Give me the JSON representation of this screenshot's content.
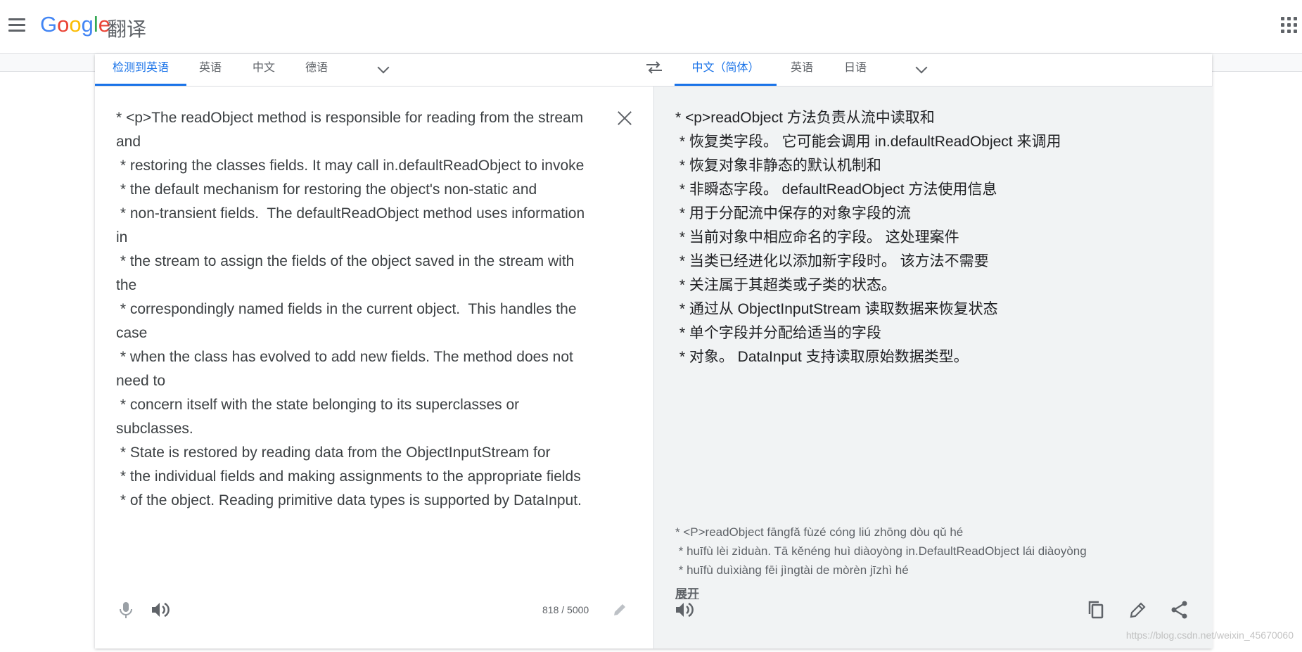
{
  "app": {
    "logo_letters": [
      "G",
      "o",
      "o",
      "g",
      "l",
      "e"
    ],
    "product_name": "翻译"
  },
  "source_tabs": [
    "检测到英语",
    "英语",
    "中文",
    "德语"
  ],
  "target_tabs": [
    "中文（简体）",
    "英语",
    "日语"
  ],
  "icons": {
    "menu": "hamburger-icon",
    "apps": "apps-grid-icon",
    "swap": "swap-arrows-icon",
    "clear": "close-icon",
    "mic": "microphone-icon",
    "speaker": "speaker-icon",
    "edit": "pencil-icon",
    "copy": "copy-icon",
    "share": "share-icon",
    "chevron": "chevron-down-icon"
  },
  "source": {
    "text": "* <p>The readObject method is responsible for reading from the stream and\n * restoring the classes fields. It may call in.defaultReadObject to invoke\n * the default mechanism for restoring the object's non-static and\n * non-transient fields.  The defaultReadObject method uses information in\n * the stream to assign the fields of the object saved in the stream with the\n * correspondingly named fields in the current object.  This handles the case\n * when the class has evolved to add new fields. The method does not need to\n * concern itself with the state belonging to its superclasses or subclasses.\n * State is restored by reading data from the ObjectInputStream for\n * the individual fields and making assignments to the appropriate fields\n * of the object. Reading primitive data types is supported by DataInput.",
    "char_count": "818 / 5000"
  },
  "target": {
    "text": "* <p>readObject 方法负责从流中读取和\n * 恢复类字段。 它可能会调用 in.defaultReadObject 来调用\n * 恢复对象非静态的默认机制和\n * 非瞬态字段。 defaultReadObject 方法使用信息\n * 用于分配流中保存的对象字段的流\n * 当前对象中相应命名的字段。 这处理案件\n * 当类已经进化以添加新字段时。 该方法不需要\n * 关注属于其超类或子类的状态。\n * 通过从 ObjectInputStream 读取数据来恢复状态\n * 单个字段并分配给适当的字段\n * 对象。 DataInput 支持读取原始数据类型。",
    "transliteration": "* <P>readObject fāngfǎ fùzé cóng liú zhōng dòu qǔ hé\n * huīfù lèi zìduàn. Tā kěnéng huì diàoyòng in.DefaultReadObject lái diàoyòng\n * huīfù duìxiàng fēi jìngtài de mòrèn jīzhì hé",
    "expand_label": "展开"
  },
  "watermark": "https://blog.csdn.net/weixin_45670060",
  "colors": {
    "accent": "#1a73e8",
    "icon": "#5f6368",
    "target_bg": "#f1f3f4"
  }
}
